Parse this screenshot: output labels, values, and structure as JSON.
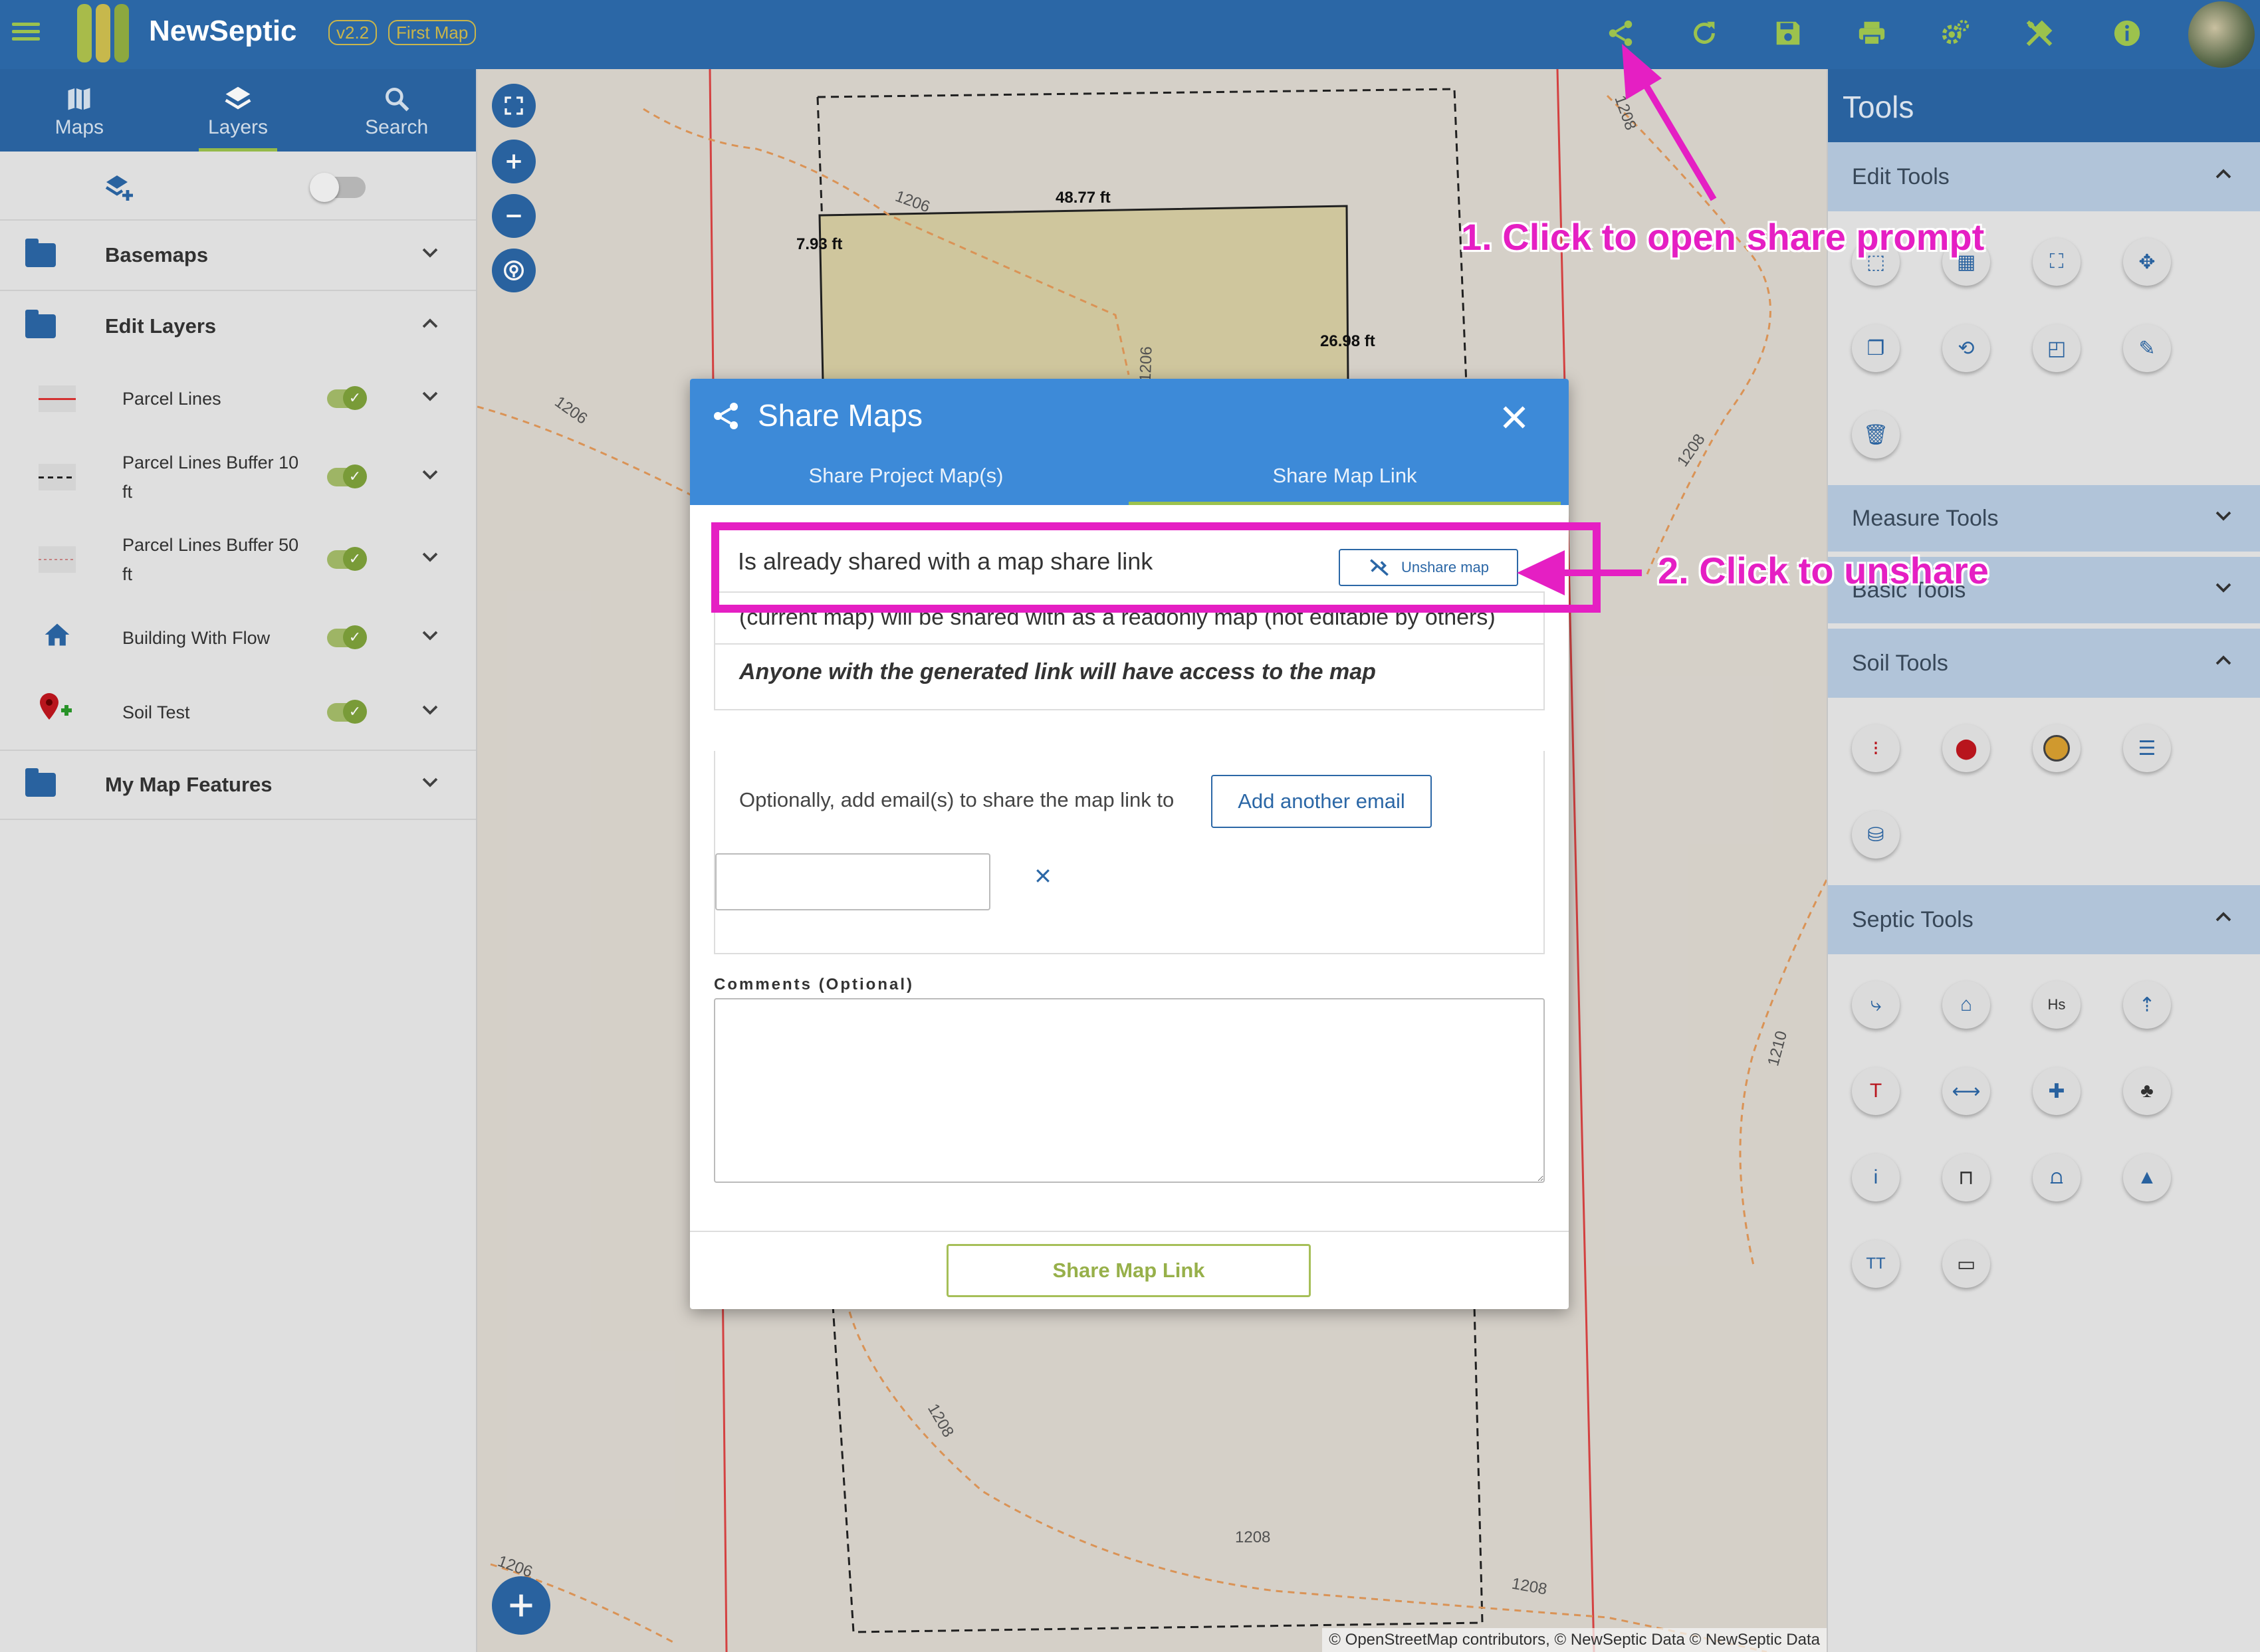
{
  "header": {
    "app_title": "NewSeptic",
    "version_badge": "v2.2",
    "map_badge": "First Map",
    "icons": [
      "menu-icon",
      "share-icon",
      "refresh-icon",
      "save-icon",
      "print-icon",
      "settings-icon",
      "tools-icon",
      "info-icon"
    ]
  },
  "sidebar": {
    "tabs": [
      {
        "label": "Maps",
        "icon": "map-icon"
      },
      {
        "label": "Layers",
        "icon": "layers-icon",
        "active": true
      },
      {
        "label": "Search",
        "icon": "search-icon"
      }
    ],
    "groups": {
      "basemaps": "Basemaps",
      "edit_layers": "Edit Layers",
      "my_map_features": "My Map Features"
    },
    "layers": [
      {
        "label": "Parcel Lines"
      },
      {
        "label": "Parcel Lines Buffer 10 ft"
      },
      {
        "label": "Parcel Lines Buffer 50 ft"
      },
      {
        "label": "Building With Flow"
      },
      {
        "label": "Soil Test"
      }
    ]
  },
  "map": {
    "dimension_labels": [
      "48.77 ft",
      "7.93 ft",
      "26.98 ft"
    ],
    "contour_labels": [
      "1206",
      "1206",
      "1206",
      "1208",
      "1208",
      "1210",
      "1208",
      "1208",
      "1208",
      "1206"
    ],
    "attribution": "© OpenStreetMap contributors, © NewSeptic Data © NewSeptic Data"
  },
  "tools": {
    "title": "Tools",
    "sections": {
      "edit": "Edit Tools",
      "measure": "Measure Tools",
      "basic": "Basic Tools",
      "soil": "Soil Tools",
      "septic": "Septic Tools"
    }
  },
  "modal": {
    "title": "Share Maps",
    "tabs": [
      "Share Project Map(s)",
      "Share Map Link"
    ],
    "already_shared_text": "Is already shared with a map share link",
    "unshare_label": "Unshare map",
    "readonly_text": "(current map) will be shared with as a readonly map (not editable by others)",
    "access_text": "Anyone with the generated link will have access to the map",
    "email_label": "Optionally, add email(s) to share the map link to",
    "add_email_label": "Add another email",
    "email_value": "",
    "comments_label": "Comments (Optional)",
    "comments_value": "",
    "share_button_label": "Share Map Link"
  },
  "annotations": {
    "step1": "1. Click to open share prompt",
    "step2": "2. Click to unshare",
    "color": "#e51fc3"
  }
}
